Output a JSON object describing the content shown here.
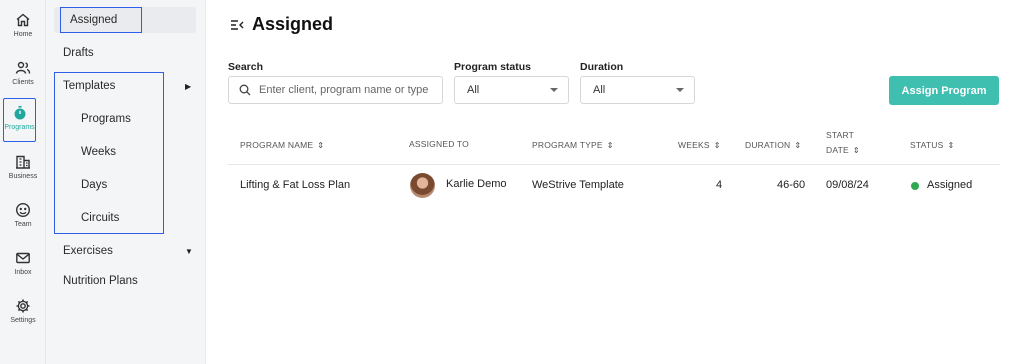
{
  "rail": {
    "items": [
      {
        "label": "Home",
        "icon": "home-icon"
      },
      {
        "label": "Clients",
        "icon": "users-icon"
      },
      {
        "label": "Programs",
        "icon": "stopwatch-icon"
      },
      {
        "label": "Business",
        "icon": "building-icon"
      },
      {
        "label": "Team",
        "icon": "team-icon"
      },
      {
        "label": "Inbox",
        "icon": "mail-icon"
      },
      {
        "label": "Settings",
        "icon": "gear-icon"
      }
    ],
    "active": "Programs",
    "active_color": "#20a8a0"
  },
  "subnav": {
    "assigned": "Assigned",
    "drafts": "Drafts",
    "templates": "Templates",
    "template_children": [
      "Programs",
      "Weeks",
      "Days",
      "Circuits"
    ],
    "exercises": "Exercises",
    "nutrition_plans": "Nutrition Plans"
  },
  "header": {
    "title": "Assigned"
  },
  "filters": {
    "search_label": "Search",
    "search_placeholder": "Enter client, program name or type",
    "status_label": "Program status",
    "status_value": "All",
    "duration_label": "Duration",
    "duration_value": "All"
  },
  "actions": {
    "assign_program": "Assign Program",
    "accent_color": "#3ebfb0"
  },
  "table": {
    "columns": {
      "program_name": "PROGRAM NAME",
      "assigned_to": "ASSIGNED TO",
      "program_type": "PROGRAM TYPE",
      "weeks": "WEEKS",
      "duration": "DURATION",
      "start_date_line1": "START",
      "start_date_line2": "DATE",
      "status": "STATUS"
    },
    "rows": [
      {
        "program_name": "Lifting & Fat Loss Plan",
        "assigned_to": "Karlie Demo",
        "program_type": "WeStrive Template",
        "weeks": "4",
        "duration": "46-60",
        "start_date": "09/08/24",
        "status": "Assigned",
        "status_color": "#2fa84f"
      }
    ]
  }
}
